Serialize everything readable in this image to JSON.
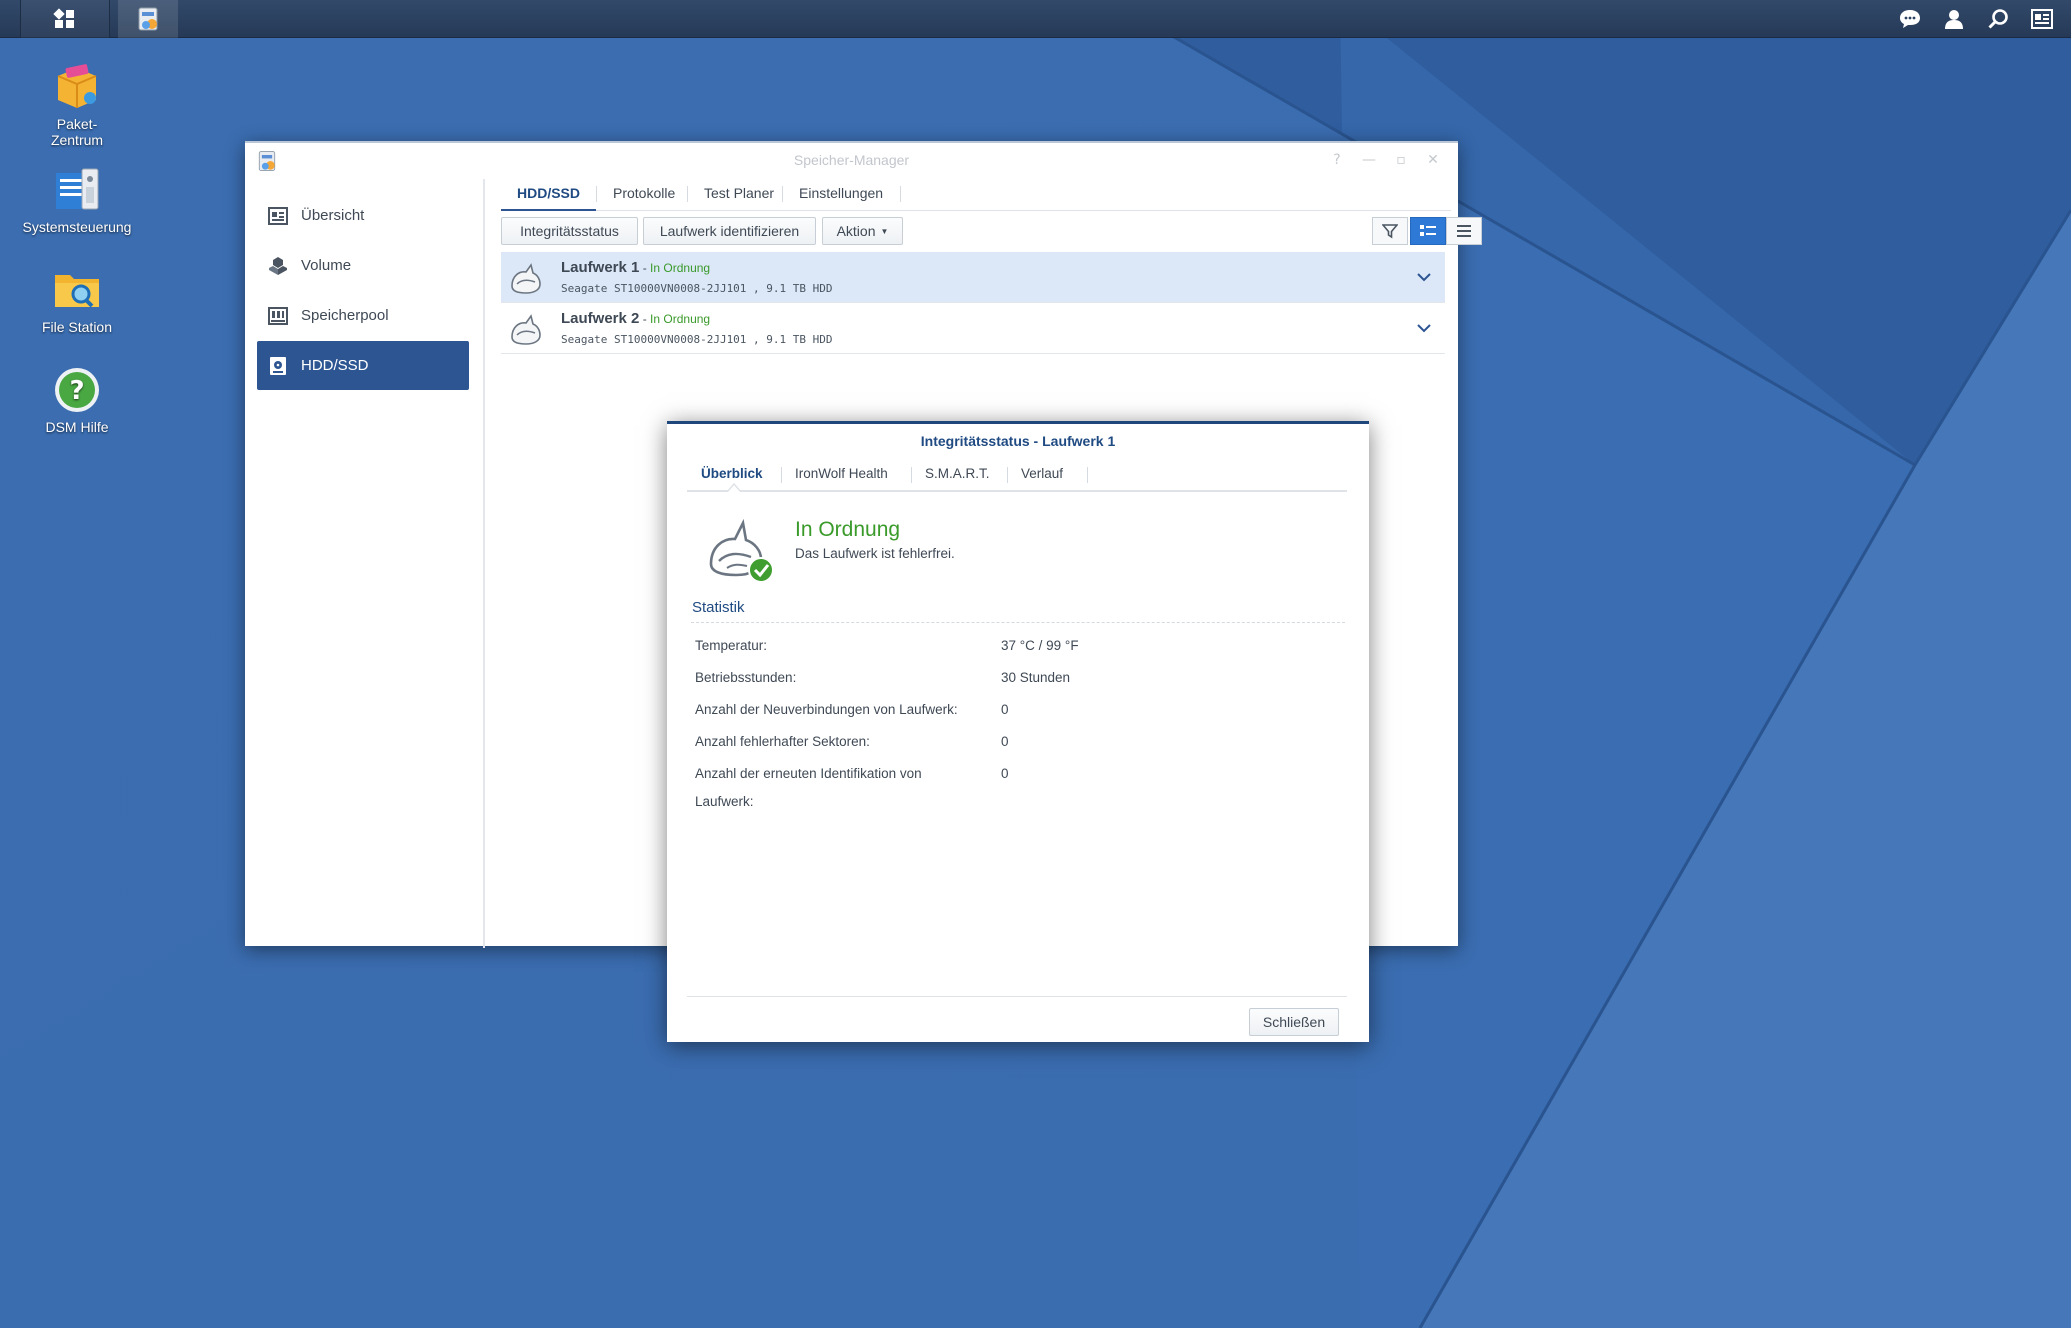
{
  "taskbar": {
    "main_menu_icon": "grid-icon",
    "app_icon": "storage-manager-icon",
    "right_icons": [
      "chat-icon",
      "user-icon",
      "search-icon",
      "widgets-icon"
    ]
  },
  "desktop": {
    "icons": [
      {
        "label": "Paket-\nZentrum",
        "icon": "package-center-icon"
      },
      {
        "label": "Systemsteuerung",
        "icon": "control-panel-icon"
      },
      {
        "label": "File Station",
        "icon": "file-station-icon"
      },
      {
        "label": "DSM Hilfe",
        "icon": "help-icon"
      }
    ]
  },
  "window": {
    "title": "Speicher-Manager",
    "controls": [
      "help-icon",
      "minimize-icon",
      "maximize-icon",
      "close-icon"
    ],
    "sidebar": [
      {
        "label": "Übersicht",
        "icon": "overview-icon",
        "active": false
      },
      {
        "label": "Volume",
        "icon": "volume-icon",
        "active": false
      },
      {
        "label": "Speicherpool",
        "icon": "storage-pool-icon",
        "active": false
      },
      {
        "label": "HDD/SSD",
        "icon": "hdd-icon",
        "active": true
      }
    ],
    "tabs": [
      "HDD/SSD",
      "Protokolle",
      "Test Planer",
      "Einstellungen"
    ],
    "active_tab": "HDD/SSD",
    "toolbar": {
      "health": "Integritätsstatus",
      "identify": "Laufwerk identifizieren",
      "action": "Aktion"
    },
    "drives": [
      {
        "name": "Laufwerk 1",
        "dash": " - ",
        "status": "In Ordnung",
        "detail": "Seagate ST10000VN0008-2JJ101 , 9.1 TB HDD",
        "selected": true
      },
      {
        "name": "Laufwerk 2",
        "dash": " - ",
        "status": "In Ordnung",
        "detail": "Seagate ST10000VN0008-2JJ101 , 9.1 TB HDD",
        "selected": false
      }
    ]
  },
  "dialog": {
    "title": "Integritätsstatus - Laufwerk 1",
    "tabs": [
      "Überblick",
      "IronWolf Health",
      "S.M.A.R.T.",
      "Verlauf"
    ],
    "active_tab": "Überblick",
    "status_title": "In Ordnung",
    "status_desc": "Das Laufwerk ist fehlerfrei.",
    "section": "Statistik",
    "stats": [
      {
        "label": "Temperatur:",
        "value": "37 °C / 99 °F"
      },
      {
        "label": "Betriebsstunden:",
        "value": "30 Stunden"
      },
      {
        "label": "Anzahl der Neuverbindungen von Laufwerk:",
        "value": "0"
      },
      {
        "label": "Anzahl fehlerhafter Sektoren:",
        "value": "0"
      },
      {
        "label": "Anzahl der erneuten Identifikation von Laufwerk:",
        "value": "0"
      }
    ],
    "close": "Schließen"
  },
  "colors": {
    "desktop": "#3768ab",
    "accent": "#2c5592",
    "ok_green": "#3a9a2a"
  }
}
